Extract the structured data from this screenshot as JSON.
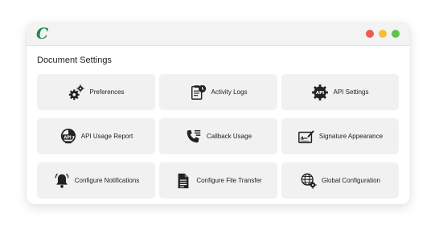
{
  "window": {
    "logo_text": "C",
    "brand_color": "#1c8a4c",
    "controls": [
      {
        "name": "close-dot",
        "color": "#ee5a52"
      },
      {
        "name": "minimize-dot",
        "color": "#f5bd3c"
      },
      {
        "name": "maximize-dot",
        "color": "#5ec544"
      }
    ]
  },
  "section": {
    "title": "Document Settings"
  },
  "tiles": [
    {
      "label": "Preferences",
      "icon": "gears-icon"
    },
    {
      "label": "Activity Logs",
      "icon": "activity-log-icon"
    },
    {
      "label": "API Settings",
      "icon": "api-gear-icon"
    },
    {
      "label": "API Usage Report",
      "icon": "api-report-icon"
    },
    {
      "label": "Callback Usage",
      "icon": "phone-callback-icon"
    },
    {
      "label": "Signature Appearance",
      "icon": "signature-icon"
    },
    {
      "label": "Configure Notifications",
      "icon": "bell-icon"
    },
    {
      "label": "Configure File Transfer",
      "icon": "file-document-icon"
    },
    {
      "label": "Global Configuration",
      "icon": "globe-gear-icon"
    }
  ]
}
